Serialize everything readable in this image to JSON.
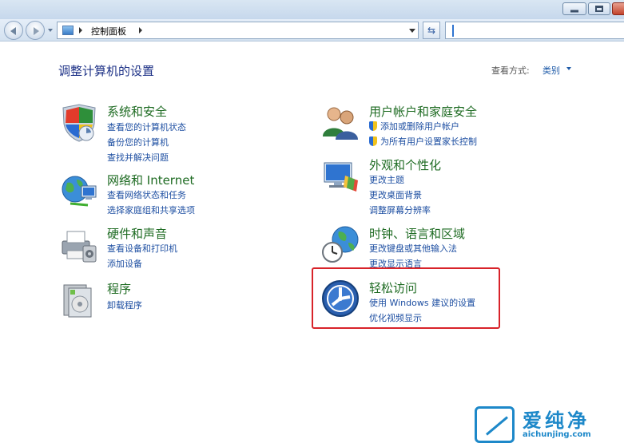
{
  "address": {
    "path_label": "控制面板"
  },
  "header": {
    "title": "调整计算机的设置",
    "view_by_label": "查看方式:",
    "view_by_value": "类别"
  },
  "categories_left": [
    {
      "title": "系统和安全",
      "links": [
        "查看您的计算机状态",
        "备份您的计算机",
        "查找并解决问题"
      ],
      "icon": "shield-icon"
    },
    {
      "title": "网络和 Internet",
      "links": [
        "查看网络状态和任务",
        "选择家庭组和共享选项"
      ],
      "icon": "network-globe-icon"
    },
    {
      "title": "硬件和声音",
      "links": [
        "查看设备和打印机",
        "添加设备"
      ],
      "icon": "printer-icon"
    },
    {
      "title": "程序",
      "links": [
        "卸载程序"
      ],
      "icon": "programs-icon"
    }
  ],
  "categories_right": [
    {
      "title": "用户帐户和家庭安全",
      "links": [
        "添加或删除用户帐户",
        "为所有用户设置家长控制"
      ],
      "icon": "users-icon"
    },
    {
      "title": "外观和个性化",
      "links": [
        "更改主题",
        "更改桌面背景",
        "调整屏幕分辨率"
      ],
      "icon": "appearance-icon"
    },
    {
      "title": "时钟、语言和区域",
      "links": [
        "更改键盘或其他输入法",
        "更改显示语言"
      ],
      "icon": "clock-globe-icon"
    },
    {
      "title": "轻松访问",
      "links": [
        "使用 Windows 建议的设置",
        "优化视频显示"
      ],
      "icon": "ease-of-access-icon"
    }
  ],
  "watermark": {
    "brand": "爱纯净",
    "url": "aichunjing.com"
  }
}
